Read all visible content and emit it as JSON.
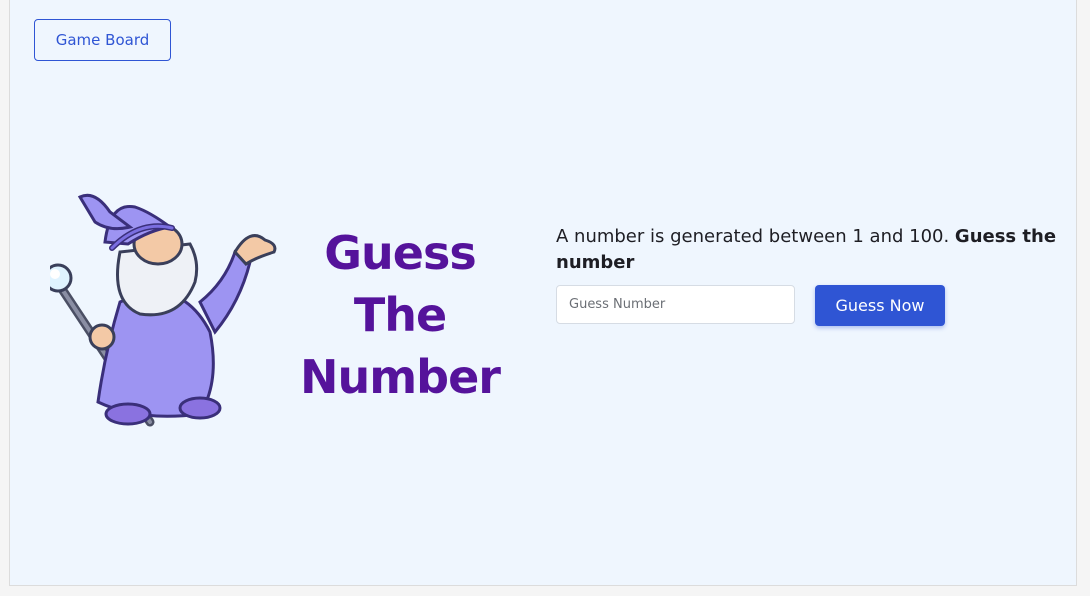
{
  "nav": {
    "game_board_label": "Game Board"
  },
  "hero": {
    "title_line1": "Guess",
    "title_line2": "The",
    "title_line3": "Number",
    "image_icon": "wizard-illustration"
  },
  "game": {
    "description_part1": "A number is generated between 1 and 100. ",
    "description_bold": "Guess the number",
    "input_placeholder": "Guess Number",
    "input_value": "",
    "button_label": "Guess Now"
  },
  "colors": {
    "accent": "#2f55d4",
    "title": "#55139b",
    "background": "#eff6fe"
  }
}
